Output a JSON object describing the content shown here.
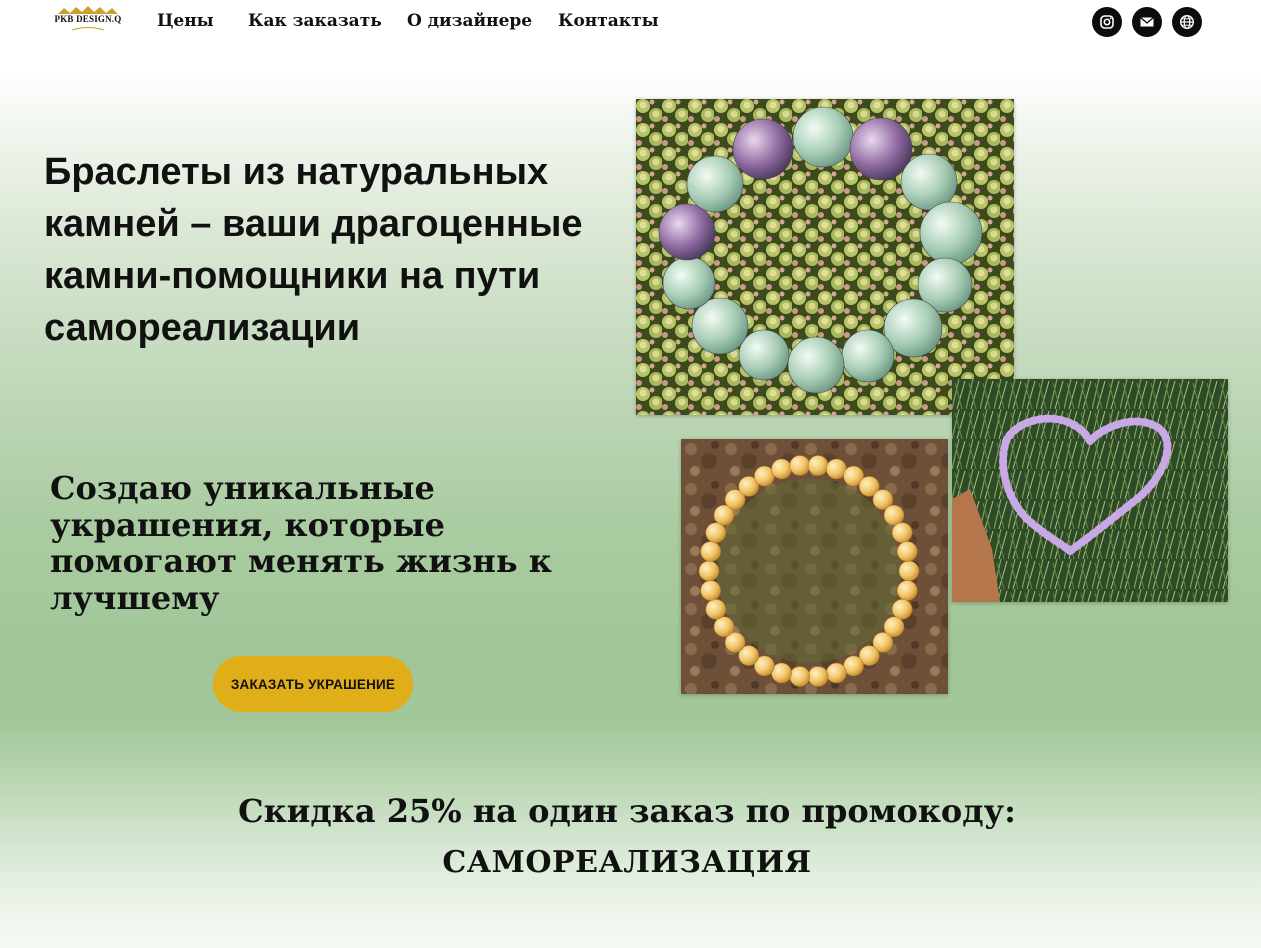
{
  "nav": {
    "logo_text": "PKB DESIGN.Q",
    "links": [
      "Цены",
      "Как заказать",
      "О дизайнере",
      "Контакты"
    ],
    "social_icons": [
      "instagram-icon",
      "mail-icon",
      "globe-icon"
    ]
  },
  "hero": {
    "title": "Браслеты из натуральных камней – ваши драгоценные камни-помощники на пути самореализации",
    "subtitle": "Создаю уникальные украшения, которые помогают менять жизнь к лучшему",
    "cta_label": "ЗАКАЗАТЬ УКРАШЕНИЕ"
  },
  "promo": {
    "line1": "Скидка 25% на один заказ по промокоду:",
    "line2": "САМОРЕАЛИЗАЦИЯ"
  },
  "colors": {
    "accent_button": "#e0ae18",
    "gradient_green": "#a0c698",
    "icon_circle": "#0c0c0c"
  }
}
